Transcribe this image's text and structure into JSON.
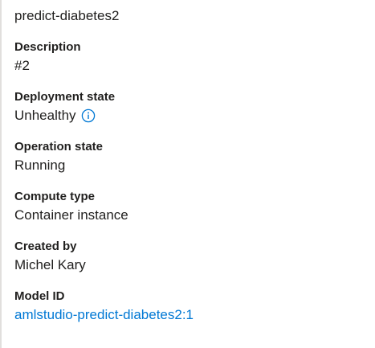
{
  "endpoint": {
    "name": "predict-diabetes2"
  },
  "details": {
    "description": {
      "label": "Description",
      "value": "#2"
    },
    "deployment_state": {
      "label": "Deployment state",
      "value": "Unhealthy",
      "icon": "info-icon"
    },
    "operation_state": {
      "label": "Operation state",
      "value": "Running"
    },
    "compute_type": {
      "label": "Compute type",
      "value": "Container instance"
    },
    "created_by": {
      "label": "Created by",
      "value": "Michel Kary"
    },
    "model_id": {
      "label": "Model ID",
      "value": "amlstudio-predict-diabetes2:1"
    }
  },
  "colors": {
    "link": "#0078d4",
    "text": "#201f1e",
    "border": "#e1dfdd"
  }
}
